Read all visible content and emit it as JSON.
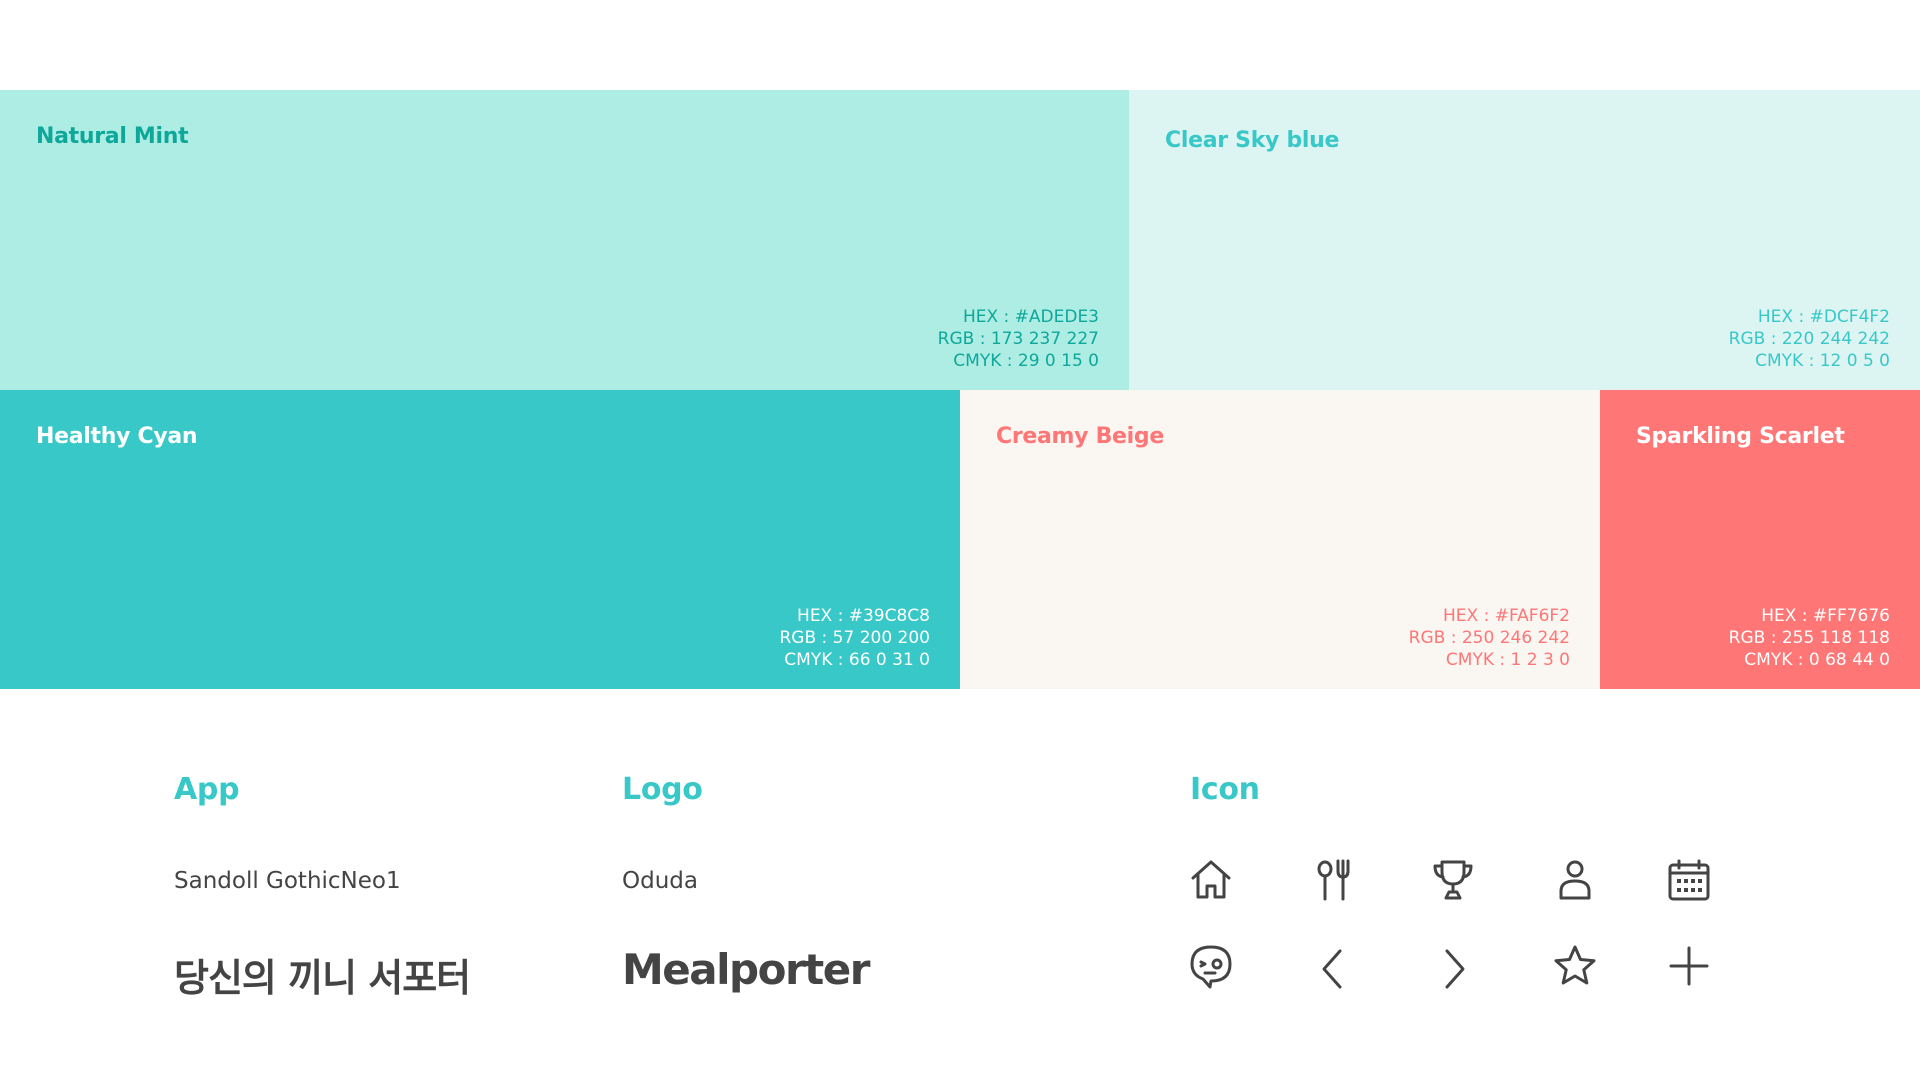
{
  "palette": [
    {
      "id": "mint",
      "name": "Natural Mint",
      "hex": "HEX : #ADEDE3",
      "rgb": "RGB : 173 237 227",
      "cmyk": "CMYK : 29 0 15 0",
      "bg": "#ADEDE3",
      "fg": "#0EA89B"
    },
    {
      "id": "sky",
      "name": "Clear Sky blue",
      "hex": "HEX : #DCF4F2",
      "rgb": "RGB : 220 244 242",
      "cmyk": "CMYK : 12 0 5 0",
      "bg": "#DCF4F2",
      "fg": "#39C8C8"
    },
    {
      "id": "cyan",
      "name": "Healthy Cyan",
      "hex": "HEX : #39C8C8",
      "rgb": "RGB : 57 200 200",
      "cmyk": "CMYK : 66 0 31 0",
      "bg": "#39C8C8",
      "fg": "#FFFFFF"
    },
    {
      "id": "beige",
      "name": "Creamy Beige",
      "hex": "HEX : #FAF6F2",
      "rgb": "RGB : 250 246 242",
      "cmyk": "CMYK : 1 2 3 0",
      "bg": "#FAF6F2",
      "fg": "#FF7676"
    },
    {
      "id": "scarlet",
      "name": "Sparkling Scarlet",
      "hex": "HEX : #FF7676",
      "rgb": "RGB : 255 118 118",
      "cmyk": "CMYK : 0 68 44 0",
      "bg": "#FF7676",
      "fg": "#FFFFFF"
    }
  ],
  "sections": {
    "accent": "#39C8C8",
    "text_color": "#444444",
    "app": {
      "title": "App",
      "font": "Sandoll GothicNeo1",
      "sample": "당신의 끼니 서포터"
    },
    "logo": {
      "title": "Logo",
      "font": "Oduda",
      "sample": "Mealporter"
    },
    "icon": {
      "title": "Icon"
    }
  },
  "icons": [
    "home-icon",
    "fork-spoon-icon",
    "trophy-icon",
    "user-icon",
    "calendar-icon",
    "chat-face-icon",
    "chevron-left-icon",
    "chevron-right-icon",
    "star-icon",
    "plus-icon"
  ]
}
